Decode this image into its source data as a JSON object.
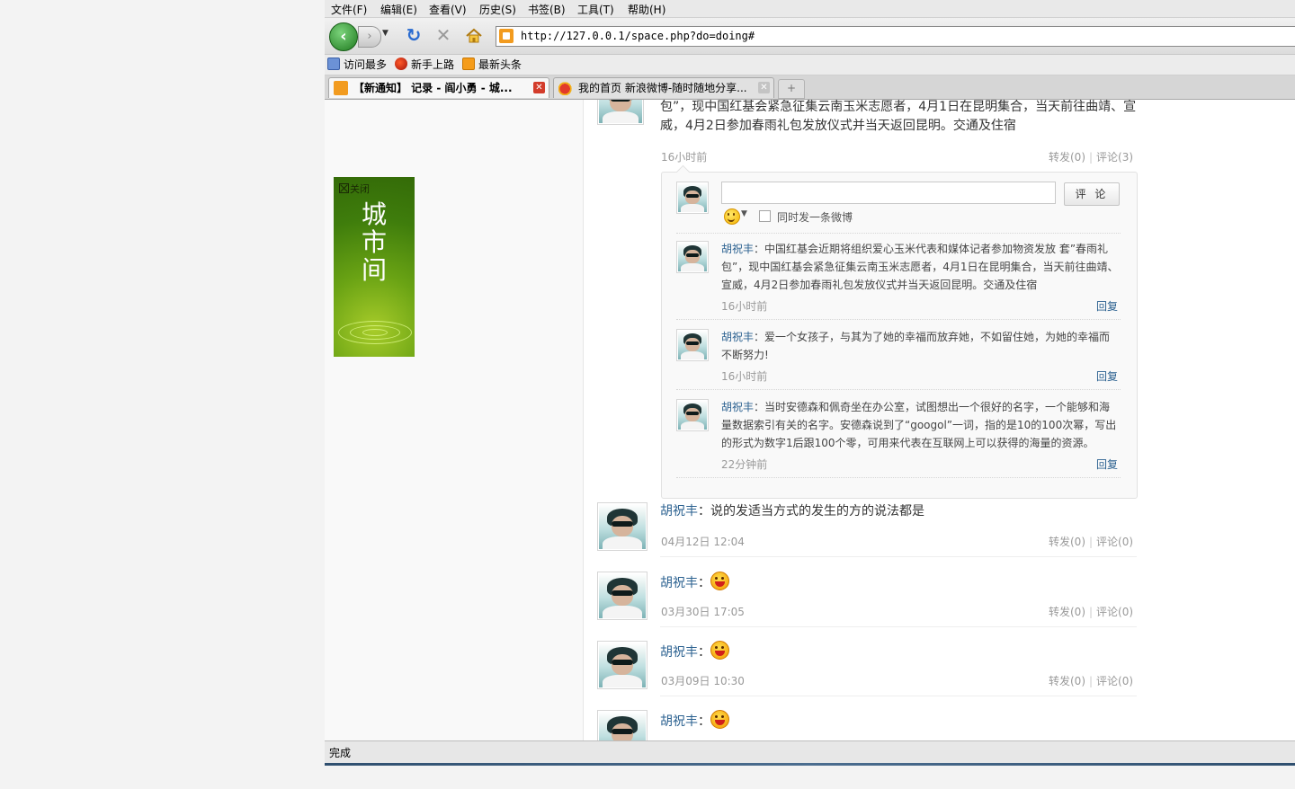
{
  "menu": [
    "文件(F)",
    "编辑(E)",
    "查看(V)",
    "历史(S)",
    "书签(B)",
    "工具(T)",
    "帮助(H)"
  ],
  "nav": {
    "url": "http://127.0.0.1/space.php?do=doing#"
  },
  "bookmarks": [
    "访问最多",
    "新手上路",
    "最新头条"
  ],
  "tabs": [
    {
      "label": "【新通知】 记录 - 阎小勇 - 城...",
      "active": true
    },
    {
      "label": "我的首页 新浪微博-随时随地分享...",
      "active": false
    }
  ],
  "ad": {
    "close": "关闭",
    "text": "城\n市\n间"
  },
  "feed": {
    "top_post": {
      "text": "包”，现中国红基会紧急征集云南玉米志愿者，4月1日在昆明集合，当天前往曲靖、宣威，4月2日参加春雨礼包发放仪式并当天返回昆明。交通及住宿",
      "time": "16小时前",
      "forward": "转发(0)",
      "comment": "评论(3)"
    },
    "comment_box": {
      "button": "评 论",
      "also_post": "同时发一条微博",
      "comments": [
        {
          "name": "胡祝丰",
          "text": "：中国红基会近期将组织爱心玉米代表和媒体记者参加物资发放 套”春雨礼包”，现中国红基会紧急征集云南玉米志愿者，4月1日在昆明集合，当天前往曲靖、宣威，4月2日参加春雨礼包发放仪式并当天返回昆明。交通及住宿",
          "time": "16小时前",
          "reply": "回复"
        },
        {
          "name": "胡祝丰",
          "text": "：爱一个女孩子，与其为了她的幸福而放弃她，不如留住她，为她的幸福而不断努力!",
          "time": "16小时前",
          "reply": "回复"
        },
        {
          "name": "胡祝丰",
          "text": "：当时安德森和佩奇坐在办公室，试图想出一个很好的名字，一个能够和海量数据索引有关的名字。安德森说到了“googol”一词，指的是10的100次幂，写出的形式为数字1后跟100个零，可用来代表在互联网上可以获得的海量的资源。",
          "time": "22分钟前",
          "reply": "回复"
        }
      ]
    },
    "posts": [
      {
        "name": "胡祝丰",
        "text": "：说的发适当方式的发生的方的说法都是",
        "time": "04月12日 12:04",
        "forward": "转发(0)",
        "comment": "评论(0)"
      },
      {
        "name": "胡祝丰",
        "text": "：",
        "time": "03月30日 17:05",
        "forward": "转发(0)",
        "comment": "评论(0)"
      },
      {
        "name": "胡祝丰",
        "text": "：",
        "time": "03月09日 10:30",
        "forward": "转发(0)",
        "comment": "评论(0)"
      },
      {
        "name": "胡祝丰",
        "text": "："
      }
    ]
  },
  "status": "完成"
}
